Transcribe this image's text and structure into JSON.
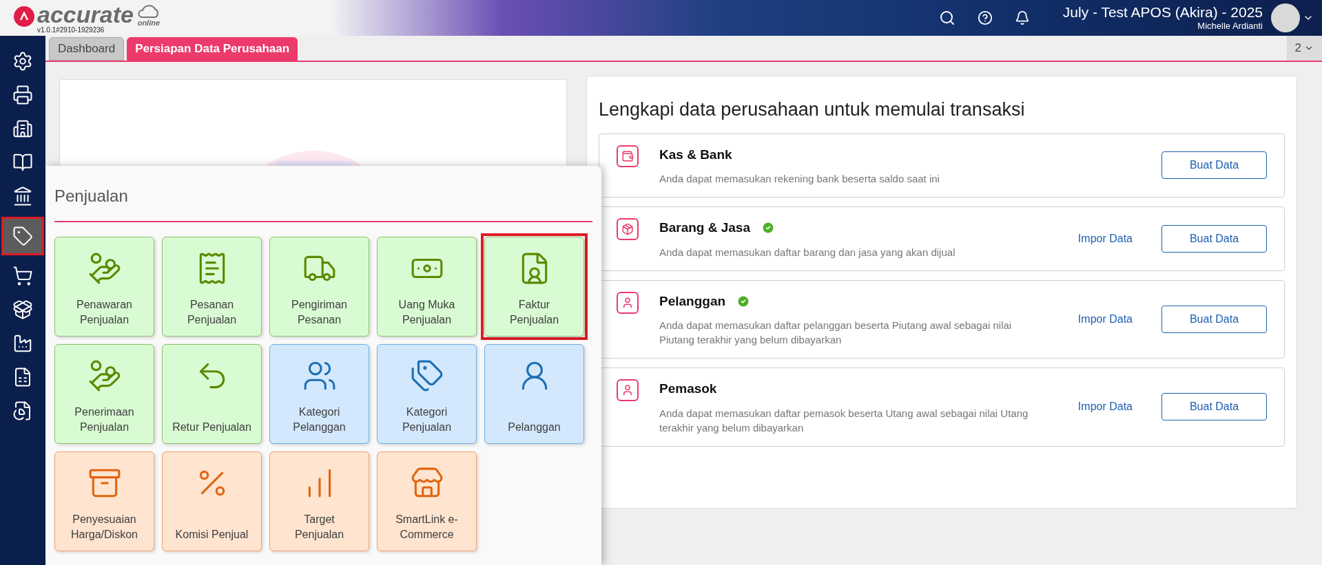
{
  "header": {
    "logo_text": "accurate",
    "logo_sub": "online",
    "version": "v1.0.1#2910-1929236",
    "company": "July - Test APOS (Akira) - 2025",
    "user": "Michelle Ardianti"
  },
  "tabs": [
    {
      "label": "Dashboard",
      "selected": false
    },
    {
      "label": "Persiapan Data Perusahaan",
      "selected": true
    }
  ],
  "tab_counter": "2",
  "sidebar": {
    "items": [
      {
        "selected": false
      },
      {
        "selected": false
      },
      {
        "selected": false
      },
      {
        "selected": false
      },
      {
        "selected": false
      },
      {
        "selected": true
      },
      {
        "selected": false
      },
      {
        "selected": false
      },
      {
        "selected": false
      },
      {
        "selected": false
      },
      {
        "selected": false
      }
    ]
  },
  "menu": {
    "title": "Penjualan",
    "tiles": [
      {
        "label": "Penawaran Penjualan",
        "kind": "green",
        "selected": false
      },
      {
        "label": "Pesanan Penjualan",
        "kind": "green",
        "selected": false
      },
      {
        "label": "Pengiriman Pesanan",
        "kind": "green",
        "selected": false
      },
      {
        "label": "Uang Muka Penjualan",
        "kind": "green",
        "selected": false
      },
      {
        "label": "Faktur Penjualan",
        "kind": "green",
        "selected": true
      },
      {
        "label": "Penerimaan Penjualan",
        "kind": "green",
        "selected": false
      },
      {
        "label": "Retur Penjualan",
        "kind": "green",
        "selected": false
      },
      {
        "label": "Kategori Pelanggan",
        "kind": "blue",
        "selected": false
      },
      {
        "label": "Kategori Penjualan",
        "kind": "blue",
        "selected": false
      },
      {
        "label": "Pelanggan",
        "kind": "blue",
        "selected": false
      },
      {
        "label": "Penyesuaian Harga/Diskon",
        "kind": "orange",
        "selected": false
      },
      {
        "label": "Komisi Penjual",
        "kind": "orange",
        "selected": false
      },
      {
        "label": "Target Penjualan",
        "kind": "orange",
        "selected": false
      },
      {
        "label": "SmartLink e-Commerce",
        "kind": "orange",
        "selected": false
      }
    ]
  },
  "setup": {
    "title": "Lengkapi data perusahaan untuk memulai transaksi",
    "items": [
      {
        "name": "Kas & Bank",
        "description": "Anda dapat memasukan rekening bank beserta saldo saat ini",
        "done": false,
        "button": "Buat Data"
      },
      {
        "name": "Barang & Jasa",
        "description": "Anda dapat memasukan daftar barang dan jasa yang akan dijual",
        "done": true,
        "import_link": "Impor Data",
        "button": "Buat Data"
      },
      {
        "name": "Pelanggan",
        "description": "Anda dapat memasukan daftar pelanggan beserta Piutang awal sebagai nilai Piutang terakhir yang belum dibayarkan",
        "done": true,
        "import_link": "Impor Data",
        "button": "Buat Data"
      },
      {
        "name": "Pemasok",
        "description": "Anda dapat memasukan daftar pemasok beserta Utang awal sebagai nilai Utang terakhir yang belum dibayarkan",
        "done": false,
        "import_link": "Impor Data",
        "button": "Buat Data"
      }
    ]
  }
}
